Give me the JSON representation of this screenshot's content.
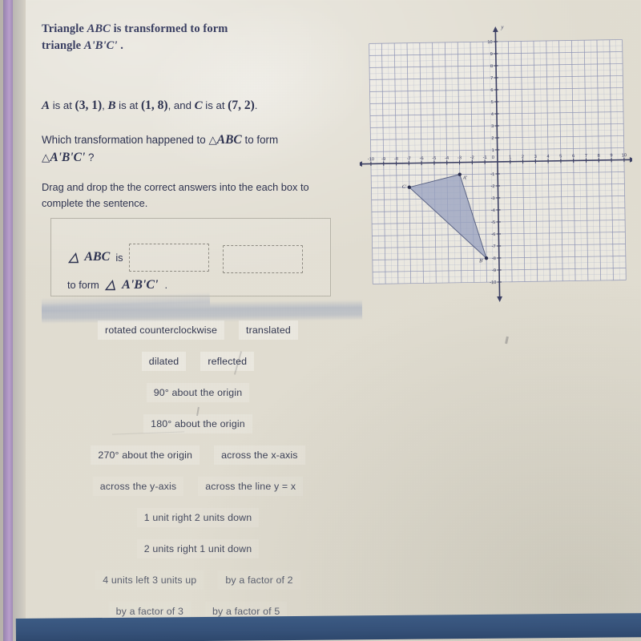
{
  "question": {
    "title_line1_pre": "Triangle ",
    "title_line1_math": "ABC",
    "title_line1_post": " is transformed to form",
    "title_line2_pre": "triangle ",
    "title_line2_math": "A'B'C'",
    "title_line2_post": " .",
    "points_text": "A is at (3, 1) , B is at (1, 8) , and C is at (7, 2) .",
    "point_a_label": "A",
    "point_a_value": "(3, 1)",
    "point_b_label": "B",
    "point_b_value": "(1, 8)",
    "point_c_label": "C",
    "point_c_value": "(7, 2)",
    "is_at_1": "is at",
    "is_at_2": "is at",
    "is_at_3": "is at",
    "and_word": ", and",
    "comma": ",",
    "period": ".",
    "ask_pre": "Which transformation happened to",
    "ask_tri1": "△",
    "ask_abc": "ABC",
    "ask_mid": "to form",
    "ask_tri2": "△",
    "ask_abc_prime": "A'B'C'",
    "ask_post": "?",
    "instruction": "Drag and drop the the correct answers into the each box to complete the sentence."
  },
  "answer_box": {
    "triangle_symbol": "△",
    "abc_label": "ABC",
    "is_word": "is",
    "to_form_word": "to form",
    "triangle_symbol2": "△",
    "abc_prime_label": "A'B'C'",
    "trailing_period": ".",
    "dropzone_1_value": "",
    "dropzone_2_value": ""
  },
  "option_tiles": [
    [
      {
        "label": "rotated counterclockwise",
        "shade": "normal"
      },
      {
        "label": "translated",
        "shade": "normal"
      }
    ],
    [
      {
        "label": "dilated",
        "shade": "normal"
      },
      {
        "label": "reflected",
        "shade": "normal"
      }
    ],
    [
      {
        "label": "90° about the origin",
        "shade": "faint"
      }
    ],
    [
      {
        "label": "180° about the origin",
        "shade": "faint"
      }
    ],
    [
      {
        "label": "270° about the origin",
        "shade": "faint"
      },
      {
        "label": "across the x-axis",
        "shade": "faint"
      }
    ],
    [
      {
        "label": "across the y-axis",
        "shade": "fainter"
      },
      {
        "label": "across the line y = x",
        "shade": "fainter"
      }
    ],
    [
      {
        "label": "1 unit right 2 units down",
        "shade": "fainter"
      }
    ],
    [
      {
        "label": "2 units right 1 unit down",
        "shade": "fainter"
      }
    ],
    [
      {
        "label": "4 units left 3 units up",
        "shade": "ghost"
      },
      {
        "label": "by a factor of 2",
        "shade": "ghost"
      }
    ],
    [
      {
        "label": "by a factor of 3",
        "shade": "ghost"
      },
      {
        "label": "by a factor of 5",
        "shade": "ghost"
      }
    ]
  ],
  "chart_data": {
    "type": "scatter",
    "title": "",
    "xlabel": "x",
    "ylabel": "y",
    "xlim": [
      -10,
      10
    ],
    "ylim": [
      -10,
      10
    ],
    "grid": true,
    "minor_grid_step": 0.5,
    "major_grid_step": 1,
    "x_axis_label_glyph": "x",
    "y_axis_label_glyph": "y",
    "x_ticks": [
      -10,
      -9,
      -8,
      -7,
      -6,
      -5,
      -4,
      -3,
      -2,
      -1,
      1,
      2,
      3,
      4,
      5,
      6,
      7,
      8,
      9,
      10
    ],
    "y_ticks": [
      -10,
      -9,
      -8,
      -7,
      -6,
      -5,
      -4,
      -3,
      -2,
      -1,
      1,
      2,
      3,
      4,
      5,
      6,
      7,
      8,
      9,
      10
    ],
    "origin_label": "0",
    "series": [
      {
        "name": "triangle A'B'C'",
        "type": "polygon",
        "fill": "#9aa3c0",
        "stroke": "#5b6485",
        "points": [
          {
            "label": "A'",
            "x": -3,
            "y": -1
          },
          {
            "label": "B'",
            "x": -1,
            "y": -8
          },
          {
            "label": "C'",
            "x": -7,
            "y": -2
          }
        ]
      }
    ],
    "annotations": [
      {
        "text": "A'",
        "x": -3,
        "y": -1
      },
      {
        "text": "B'",
        "x": -1,
        "y": -8
      },
      {
        "text": "C'",
        "x": -7,
        "y": -2
      }
    ]
  },
  "colors": {
    "paper": "#e2ded2",
    "ink": "#2d3250",
    "title_ink": "#3a3f62",
    "grid_line": "#8f95b5",
    "axis_line": "#3b3f63",
    "triangle_fill": "#9aa3c0",
    "triangle_stroke": "#5b6485",
    "edge_purple": "#a68cc0",
    "bottom_bar": "#36527a",
    "dropzone_border": "#8e8b82"
  }
}
